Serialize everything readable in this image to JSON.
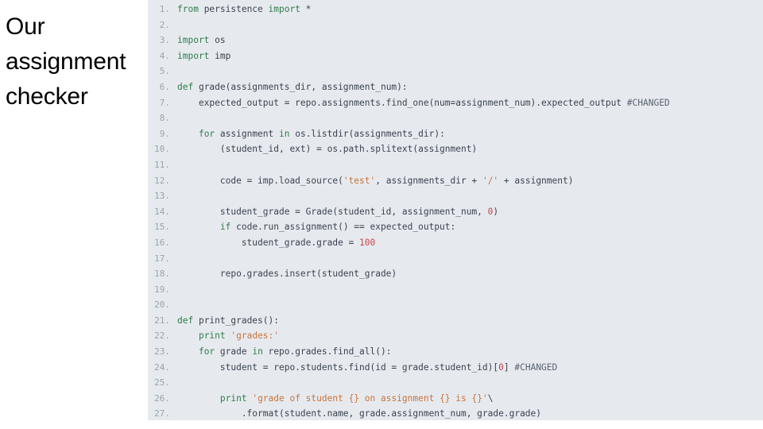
{
  "slide": {
    "background_color": "#ffffff",
    "title": "Our\nassignment\nchecker"
  },
  "code_panel": {
    "background_color": "#e6eaef",
    "language": "python",
    "line_number_color": "#9aa3ad",
    "text_color": "#3b4250",
    "keyword_color": "#2f7d45",
    "string_color": "#c8743c",
    "number_color": "#c9414a",
    "comment_color": "#5b6472",
    "first_line_number": 1,
    "last_line_number": 27,
    "lines": [
      {
        "n": "1",
        "tokens": [
          {
            "t": "kw",
            "v": "from"
          },
          {
            "t": "plain",
            "v": " persistence "
          },
          {
            "t": "kw",
            "v": "import"
          },
          {
            "t": "plain",
            "v": " *"
          }
        ]
      },
      {
        "n": "2",
        "tokens": [
          {
            "t": "plain",
            "v": ""
          }
        ]
      },
      {
        "n": "3",
        "tokens": [
          {
            "t": "kw",
            "v": "import"
          },
          {
            "t": "plain",
            "v": " os"
          }
        ]
      },
      {
        "n": "4",
        "tokens": [
          {
            "t": "kw",
            "v": "import"
          },
          {
            "t": "plain",
            "v": " imp"
          }
        ]
      },
      {
        "n": "5",
        "tokens": [
          {
            "t": "plain",
            "v": ""
          }
        ]
      },
      {
        "n": "6",
        "tokens": [
          {
            "t": "kw",
            "v": "def"
          },
          {
            "t": "plain",
            "v": " grade(assignments_dir, assignment_num):"
          }
        ]
      },
      {
        "n": "7",
        "tokens": [
          {
            "t": "plain",
            "v": "    expected_output = repo.assignments.find_one(num=assignment_num).expected_output "
          },
          {
            "t": "com",
            "v": "#CHANGED"
          }
        ]
      },
      {
        "n": "8",
        "tokens": [
          {
            "t": "plain",
            "v": ""
          }
        ]
      },
      {
        "n": "9",
        "tokens": [
          {
            "t": "plain",
            "v": "    "
          },
          {
            "t": "kw",
            "v": "for"
          },
          {
            "t": "plain",
            "v": " assignment "
          },
          {
            "t": "kw",
            "v": "in"
          },
          {
            "t": "plain",
            "v": " os.listdir(assignments_dir):"
          }
        ]
      },
      {
        "n": "10",
        "tokens": [
          {
            "t": "plain",
            "v": "        (student_id, ext) = os.path.splitext(assignment)"
          }
        ]
      },
      {
        "n": "11",
        "tokens": [
          {
            "t": "plain",
            "v": ""
          }
        ]
      },
      {
        "n": "12",
        "tokens": [
          {
            "t": "plain",
            "v": "        code = imp.load_source("
          },
          {
            "t": "str",
            "v": "'test'"
          },
          {
            "t": "plain",
            "v": ", assignments_dir + "
          },
          {
            "t": "str",
            "v": "'/'"
          },
          {
            "t": "plain",
            "v": " + assignment)"
          }
        ]
      },
      {
        "n": "13",
        "tokens": [
          {
            "t": "plain",
            "v": ""
          }
        ]
      },
      {
        "n": "14",
        "tokens": [
          {
            "t": "plain",
            "v": "        student_grade = Grade(student_id, assignment_num, "
          },
          {
            "t": "num",
            "v": "0"
          },
          {
            "t": "plain",
            "v": ")"
          }
        ]
      },
      {
        "n": "15",
        "tokens": [
          {
            "t": "plain",
            "v": "        "
          },
          {
            "t": "kw",
            "v": "if"
          },
          {
            "t": "plain",
            "v": " code.run_assignment() == expected_output:"
          }
        ]
      },
      {
        "n": "16",
        "tokens": [
          {
            "t": "plain",
            "v": "            student_grade.grade = "
          },
          {
            "t": "num",
            "v": "100"
          }
        ]
      },
      {
        "n": "17",
        "tokens": [
          {
            "t": "plain",
            "v": ""
          }
        ]
      },
      {
        "n": "18",
        "tokens": [
          {
            "t": "plain",
            "v": "        repo.grades.insert(student_grade)"
          }
        ]
      },
      {
        "n": "19",
        "tokens": [
          {
            "t": "plain",
            "v": ""
          }
        ]
      },
      {
        "n": "20",
        "tokens": [
          {
            "t": "plain",
            "v": ""
          }
        ]
      },
      {
        "n": "21",
        "tokens": [
          {
            "t": "kw",
            "v": "def"
          },
          {
            "t": "plain",
            "v": " print_grades():"
          }
        ]
      },
      {
        "n": "22",
        "tokens": [
          {
            "t": "plain",
            "v": "    "
          },
          {
            "t": "kw",
            "v": "print"
          },
          {
            "t": "plain",
            "v": " "
          },
          {
            "t": "str",
            "v": "'grades:'"
          }
        ]
      },
      {
        "n": "23",
        "tokens": [
          {
            "t": "plain",
            "v": "    "
          },
          {
            "t": "kw",
            "v": "for"
          },
          {
            "t": "plain",
            "v": " grade "
          },
          {
            "t": "kw",
            "v": "in"
          },
          {
            "t": "plain",
            "v": " repo.grades.find_all():"
          }
        ]
      },
      {
        "n": "24",
        "tokens": [
          {
            "t": "plain",
            "v": "        student = repo.students.find(id = grade.student_id)["
          },
          {
            "t": "num",
            "v": "0"
          },
          {
            "t": "plain",
            "v": "] "
          },
          {
            "t": "com",
            "v": "#CHANGED"
          }
        ]
      },
      {
        "n": "25",
        "tokens": [
          {
            "t": "plain",
            "v": ""
          }
        ]
      },
      {
        "n": "26",
        "tokens": [
          {
            "t": "plain",
            "v": "        "
          },
          {
            "t": "kw",
            "v": "print"
          },
          {
            "t": "plain",
            "v": " "
          },
          {
            "t": "str",
            "v": "'grade of student {} on assignment {} is {}'"
          },
          {
            "t": "plain",
            "v": "\\"
          }
        ]
      },
      {
        "n": "27",
        "tokens": [
          {
            "t": "plain",
            "v": "            .format(student.name, grade.assignment_num, grade.grade)"
          }
        ]
      }
    ]
  }
}
